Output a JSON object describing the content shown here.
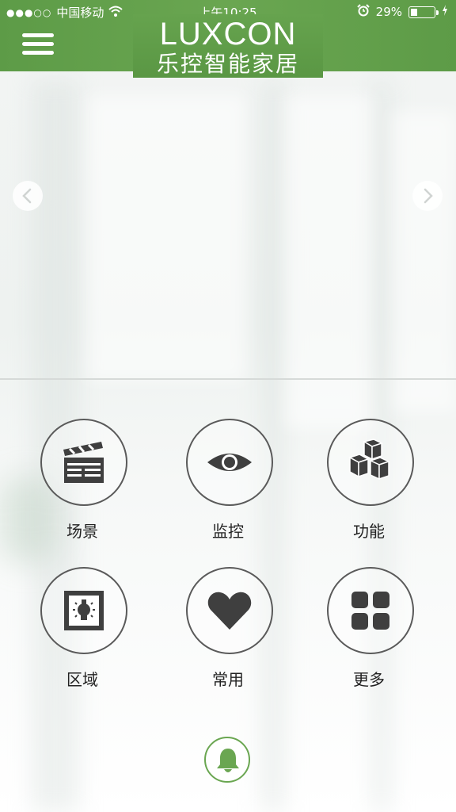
{
  "status_bar": {
    "signal": "●●●○○",
    "carrier": "中国移动",
    "time": "上午10:25",
    "battery_text": "29%",
    "battery_level": 0.29,
    "icons": [
      "wifi-icon",
      "alarm-icon",
      "charging-icon"
    ]
  },
  "header": {
    "menu_icon": "menu-icon",
    "logo_en": "LUXCON",
    "logo_cn": "乐控智能家居",
    "accent_color": "#6aa651"
  },
  "banner": {
    "prev_icon": "chevron-left-icon",
    "next_icon": "chevron-right-icon"
  },
  "grid": {
    "items": [
      {
        "label": "场景",
        "icon": "clapperboard-icon"
      },
      {
        "label": "监控",
        "icon": "eye-icon"
      },
      {
        "label": "功能",
        "icon": "cubes-icon"
      },
      {
        "label": "区域",
        "icon": "room-bulb-icon"
      },
      {
        "label": "常用",
        "icon": "heart-icon"
      },
      {
        "label": "更多",
        "icon": "grid-icon"
      }
    ]
  },
  "footer": {
    "bell_icon": "bell-icon"
  }
}
